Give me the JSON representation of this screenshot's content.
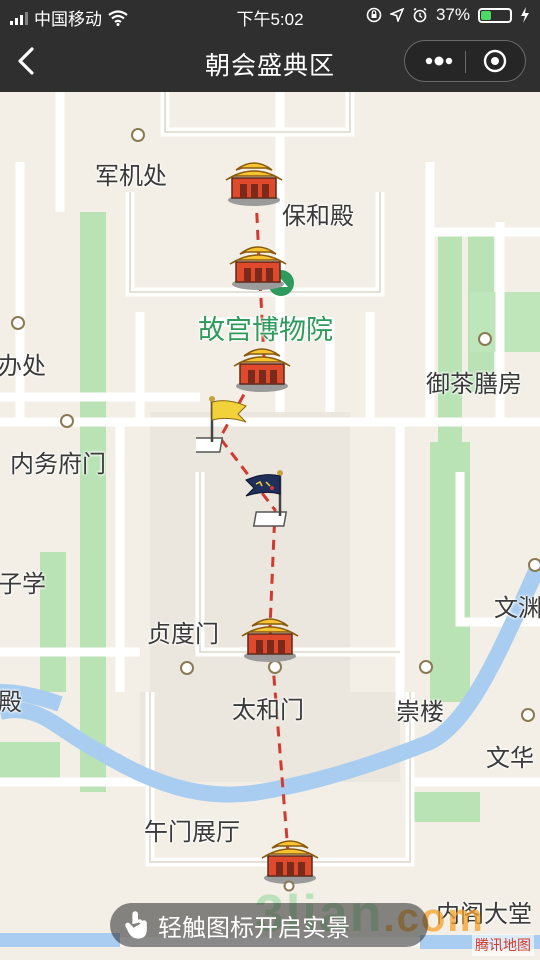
{
  "status_bar": {
    "carrier": "中国移动",
    "time": "下午5:02",
    "battery_percent": "37%",
    "battery_level": 0.37
  },
  "nav": {
    "title": "朝会盛典区",
    "back_icon": "back-arrow-icon",
    "more_icon": "more-dots-icon",
    "close_icon": "target-close-icon"
  },
  "map": {
    "poi": {
      "junjichu": "军机处",
      "baohedian": "保和殿",
      "museum": "故宫博物院",
      "banchu": "办处",
      "yucha": "御茶膳房",
      "neiwufu": "内务府门",
      "zixue": "子学",
      "wenyuan": "文渊",
      "zhendumen": "贞度门",
      "dian": "殿",
      "taihemen": "太和门",
      "chonglou": "崇楼",
      "wenhua": "文华",
      "wumen_hall": "午门展厅",
      "neige": "内阁大堂"
    },
    "colors": {
      "route": "#d33a2f",
      "river": "#a9cdf0",
      "park": "#b9e2b5",
      "road": "#ffffff"
    }
  },
  "touch_bar": {
    "label": "轻触图标开启实景"
  },
  "watermark": {
    "text": "3lian",
    "suffix": ".com"
  },
  "provider_logo": "腾讯地图"
}
